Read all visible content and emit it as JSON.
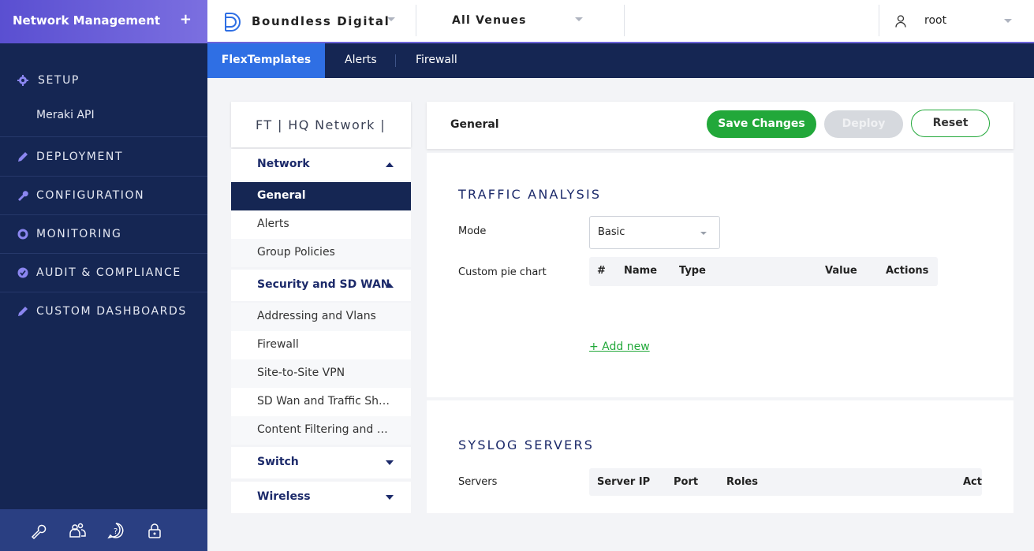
{
  "sidebar": {
    "title": "Network Management",
    "add_symbol": "+",
    "items": [
      {
        "label": "SETUP",
        "icon": "gear-icon"
      },
      {
        "label": "DEPLOYMENT",
        "icon": "pencil-icon"
      },
      {
        "label": "CONFIGURATION",
        "icon": "wrench-icon"
      },
      {
        "label": "MONITORING",
        "icon": "ring-icon"
      },
      {
        "label": "AUDIT & COMPLIANCE",
        "icon": "check-badge-icon"
      },
      {
        "label": "CUSTOM DASHBOARDS",
        "icon": "pencil-icon"
      }
    ],
    "setup_sub_item": "Meraki API",
    "bottom_icons": [
      "wrench-icon",
      "users-icon",
      "help-icon",
      "lock-icon"
    ]
  },
  "topbar": {
    "brand": "Boundless Digital",
    "venue": "All Venues",
    "user": "root"
  },
  "tabs": [
    {
      "label": "FlexTemplates",
      "active": true
    },
    {
      "label": "Alerts",
      "active": false
    },
    {
      "label": "Firewall",
      "active": false
    }
  ],
  "template": {
    "title": "FT | HQ Network |",
    "groups": [
      {
        "label": "Network",
        "expanded": true,
        "items": [
          "General",
          "Alerts",
          "Group Policies"
        ]
      },
      {
        "label": "Security and SD WAN",
        "expanded": true,
        "items": [
          "Addressing and Vlans",
          "Firewall",
          "Site-to-Site VPN",
          "SD Wan and Traffic Shaping",
          "Content Filtering and Threat Protection"
        ]
      },
      {
        "label": "Switch",
        "expanded": false,
        "items": []
      },
      {
        "label": "Wireless",
        "expanded": false,
        "items": []
      }
    ],
    "active_item": "General"
  },
  "main": {
    "header": "General",
    "save_label": "Save Changes",
    "deploy_label": "Deploy",
    "reset_label": "Reset",
    "traffic": {
      "title": "TRAFFIC ANALYSIS",
      "mode_label": "Mode",
      "mode_value": "Basic",
      "pie_label": "Custom pie chart",
      "columns": [
        "#",
        "Name",
        "Type",
        "Value",
        "Actions"
      ],
      "add_new": "+ Add new"
    },
    "syslog": {
      "title": "SYSLOG SERVERS",
      "servers_label": "Servers",
      "columns": [
        "Server IP",
        "Port",
        "Roles",
        "Acti"
      ]
    }
  },
  "colors": {
    "sidebar_bg": "#152653",
    "accent_purple": "#6b63d9",
    "active_tab": "#2f6fe4",
    "save_green": "#22a83a"
  }
}
